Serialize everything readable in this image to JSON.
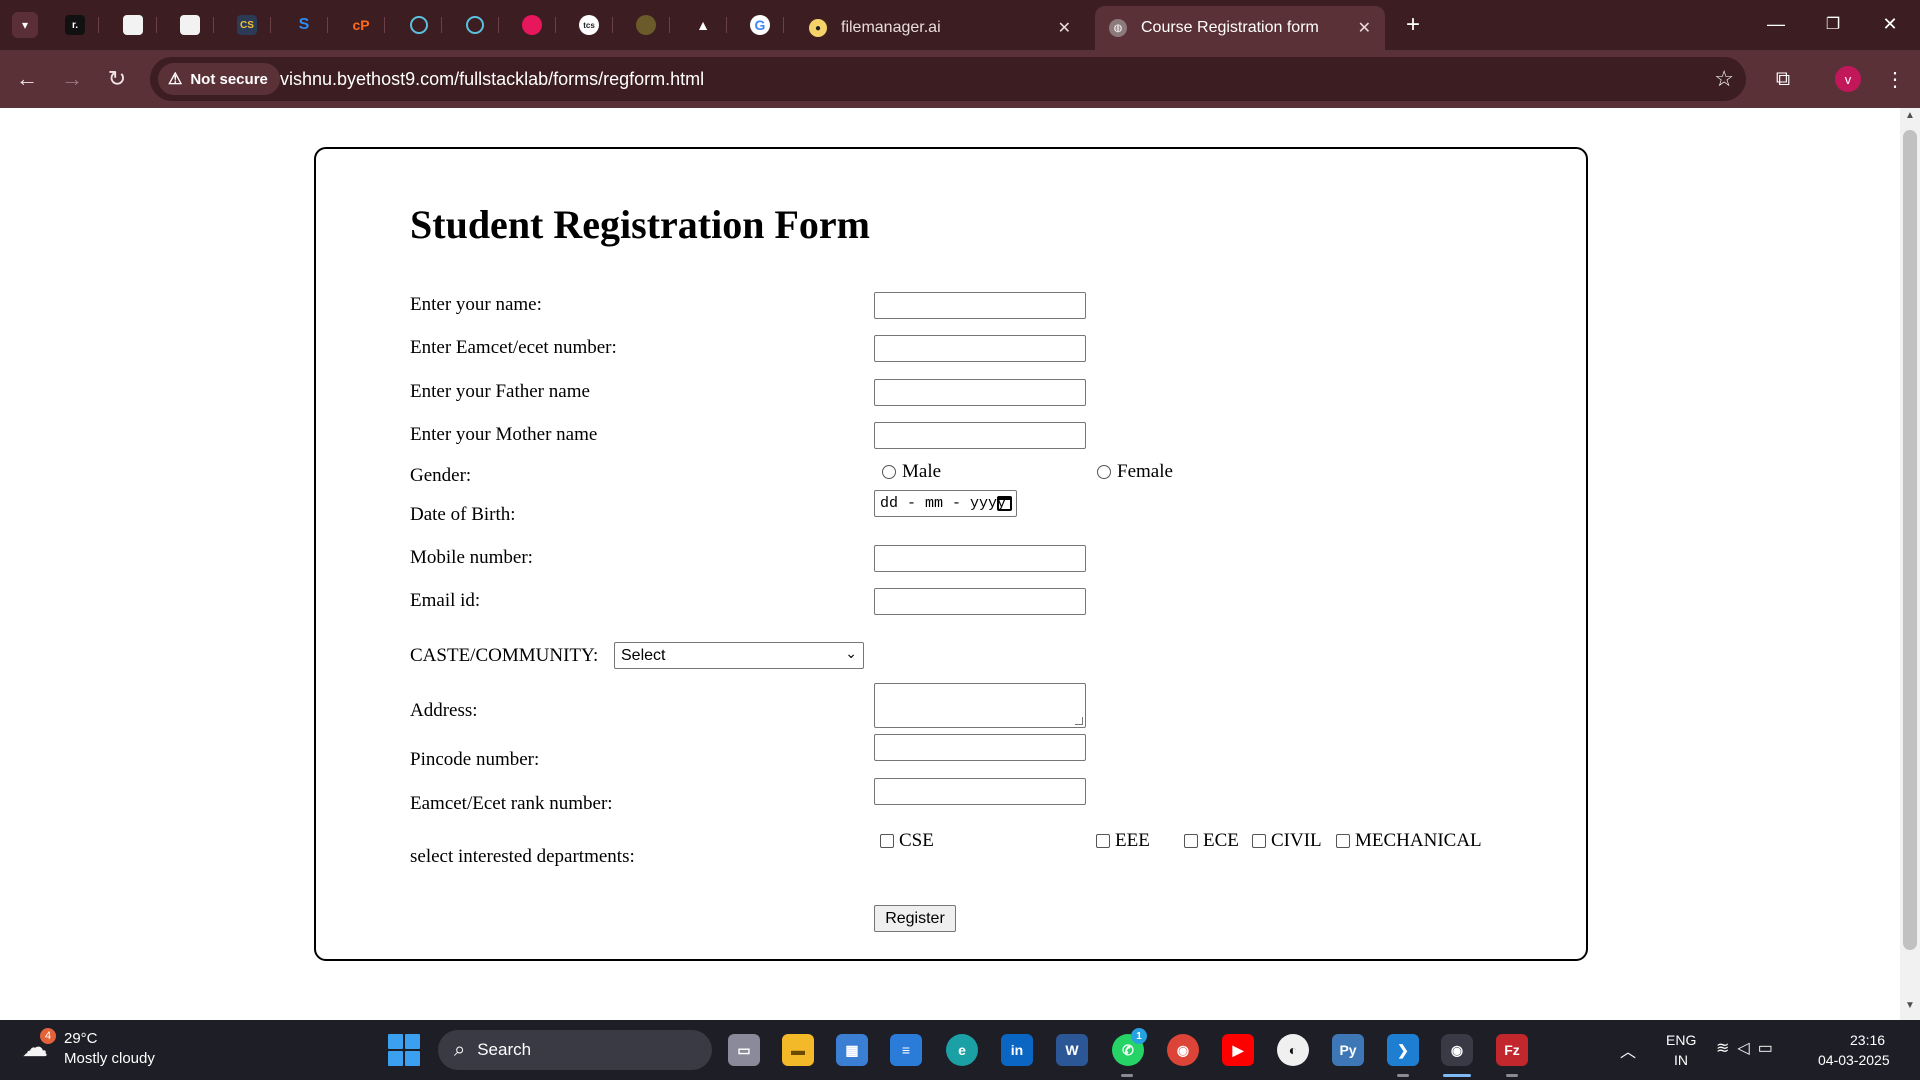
{
  "browser": {
    "tabs": [
      {
        "title": "filemanager.ai"
      },
      {
        "title": "Course Registration form",
        "active": true
      }
    ],
    "security_label": "Not secure",
    "url": "vishnu.byethost9.com/fullstacklab/forms/regform.html",
    "profile_initial": "v"
  },
  "form": {
    "title": "Student Registration Form",
    "labels": {
      "name": "Enter your name:",
      "eamcet": "Enter Eamcet/ecet number:",
      "father": "Enter your Father name",
      "mother": "Enter your Mother name",
      "gender": "Gender:",
      "dob": "Date of Birth:",
      "mobile": "Mobile number:",
      "email": "Email id:",
      "caste": "CASTE/COMMUNITY:",
      "address": "Address:",
      "pincode": "Pincode number:",
      "rank": "Eamcet/Ecet rank number:",
      "departments": "select interested departments:"
    },
    "gender_options": [
      "Male",
      "Female"
    ],
    "dob_placeholder": "dd - mm - yyyy",
    "caste_selected": "Select",
    "departments": [
      "CSE",
      "EEE",
      "ECE",
      "CIVIL",
      "MECHANICAL"
    ],
    "submit_label": "Register"
  },
  "taskbar": {
    "weather_temp": "29°C",
    "weather_desc": "Mostly cloudy",
    "weather_badge": "4",
    "search_label": "Search",
    "whatsapp_badge": "1",
    "language_top": "ENG",
    "language_bottom": "IN",
    "time": "23:16",
    "date": "04-03-2025"
  }
}
